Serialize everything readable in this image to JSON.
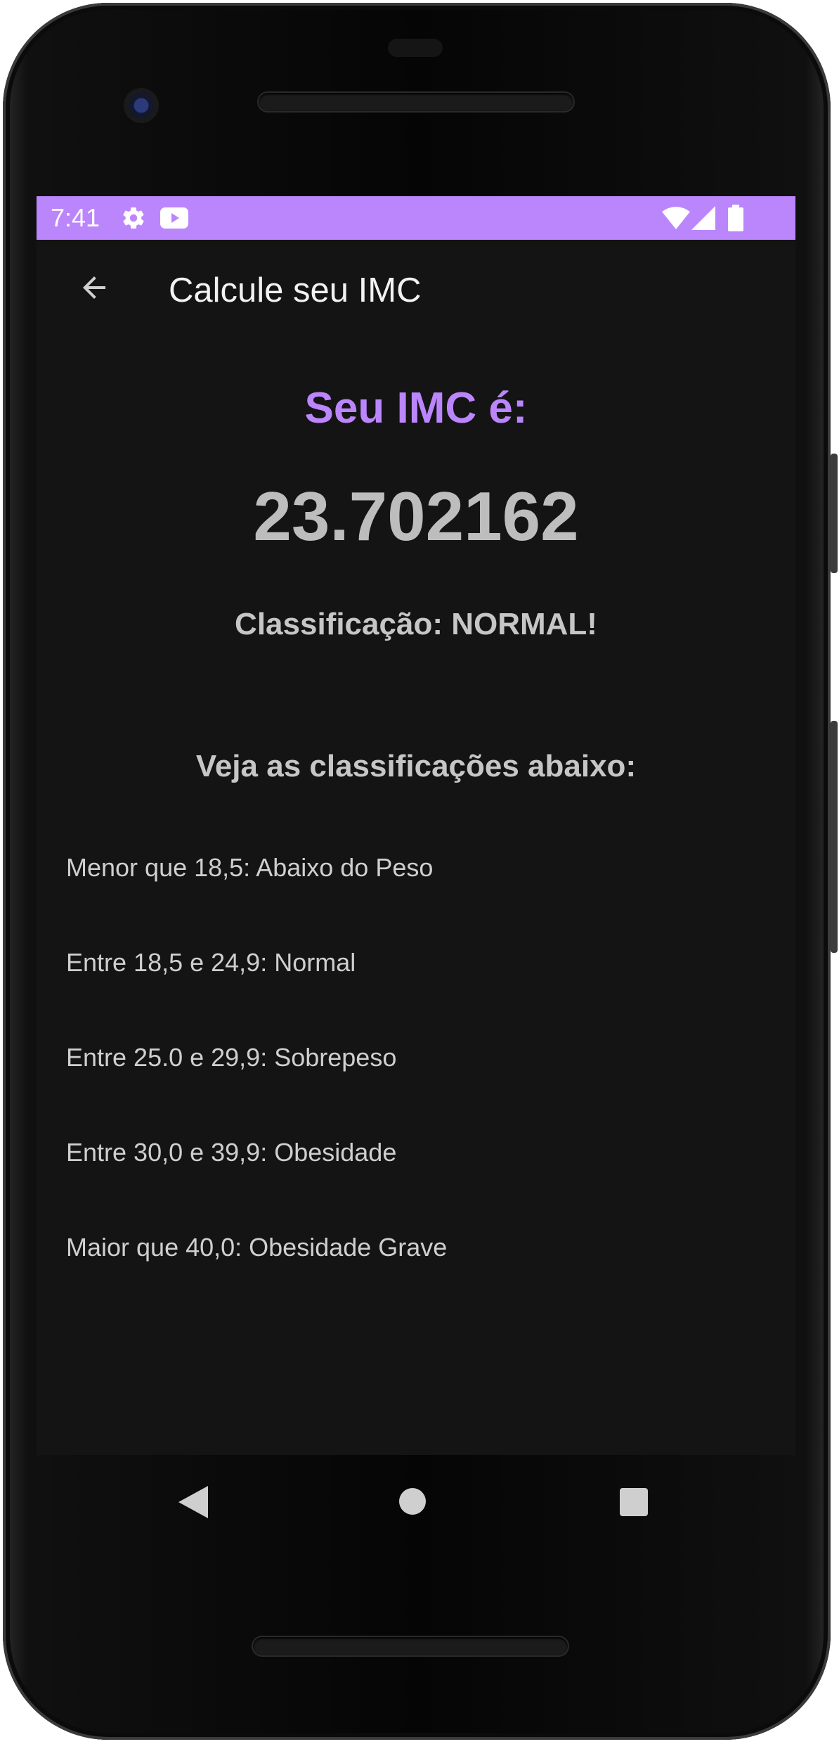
{
  "statusbar": {
    "time": "7:41",
    "icons": [
      "gear-icon",
      "youtube-icon",
      "wifi-icon",
      "signal-icon",
      "battery-icon"
    ],
    "color": "#bb86fc"
  },
  "appbar": {
    "back_icon": "arrow-left-icon",
    "title": "Calcule seu IMC"
  },
  "result": {
    "heading": "Seu IMC é:",
    "value": "23.702162",
    "classification": "Classificação: NORMAL!",
    "heading_color": "#bb86fc"
  },
  "reference": {
    "heading": "Veja as classificações abaixo:",
    "items": [
      "Menor que 18,5: Abaixo do Peso",
      "Entre 18,5 e 24,9: Normal",
      "Entre 25.0 e 29,9: Sobrepeso",
      "Entre 30,0 e 39,9: Obesidade",
      "Maior que 40,0: Obesidade Grave"
    ]
  },
  "navbar": {
    "icons": [
      "nav-back-icon",
      "nav-home-icon",
      "nav-recents-icon"
    ]
  }
}
